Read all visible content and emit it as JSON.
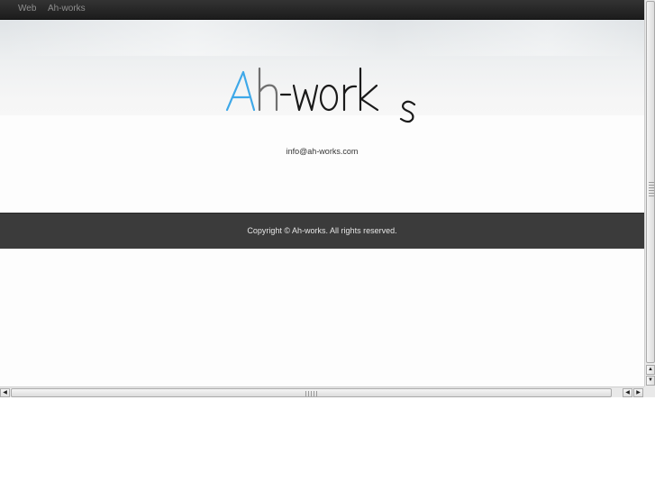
{
  "nav": {
    "items": [
      {
        "label": "Web"
      },
      {
        "label": "Ah-works"
      }
    ]
  },
  "logo": {
    "text": "Ah-works",
    "colors": {
      "A": "#3ea8e8",
      "h": "#6f6f6f",
      "rest": "#1a1a1a"
    }
  },
  "contact": {
    "email": "info@ah-works.com"
  },
  "footer": {
    "copyright": "Copyright © Ah-works. All rights reserved."
  },
  "colors": {
    "topbar": "#222222",
    "footer": "#3b3b3b",
    "accent": "#3ea8e8"
  },
  "scrollbars": {
    "vertical": {
      "up_icon": "arrow-up-icon",
      "down_icon": "arrow-down-icon"
    },
    "horizontal": {
      "left_icon": "arrow-left-icon",
      "right_icon": "arrow-right-icon"
    }
  }
}
